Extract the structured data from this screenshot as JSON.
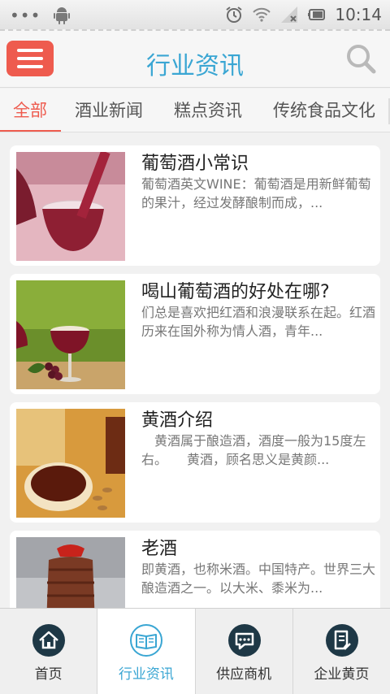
{
  "status_bar": {
    "time": "10:14",
    "dots": "•••"
  },
  "header": {
    "title": "行业资讯"
  },
  "tabs": [
    {
      "label": "全部"
    },
    {
      "label": "酒业新闻"
    },
    {
      "label": "糕点资讯"
    },
    {
      "label": "传统食品文化"
    }
  ],
  "articles": [
    {
      "title": "葡萄酒小常识",
      "desc": "葡萄酒英文WINE：葡萄酒是用新鲜葡萄的果汁，经过发酵酿制而成，..."
    },
    {
      "title": "喝山葡萄酒的好处在哪?",
      "desc": "们总是喜欢把红酒和浪漫联系在起。红酒历来在国外称为情人酒，青年..."
    },
    {
      "title": "黄酒介绍",
      "desc": "　黄酒属于酿造酒，酒度一般为15度左右。　　黄酒，顾名思义是黄颜..."
    },
    {
      "title": "老酒",
      "desc": "即黄酒，也称米酒。中国特产。世界三大酿造酒之一。以大米、黍米为..."
    }
  ],
  "bottom_nav": [
    {
      "label": "首页"
    },
    {
      "label": "行业资讯"
    },
    {
      "label": "供应商机"
    },
    {
      "label": "企业黄页"
    }
  ],
  "colors": {
    "accent_red": "#ee5b4e",
    "accent_blue": "#3aa6d3",
    "nav_icon_dark": "#1e3846"
  }
}
